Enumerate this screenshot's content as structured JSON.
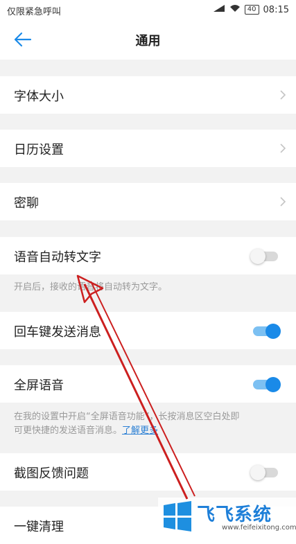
{
  "statusbar": {
    "carrier": "仅限紧急呼叫",
    "battery": "40",
    "time": "08:15"
  },
  "header": {
    "title": "通用"
  },
  "settings": {
    "font_size": "字体大小",
    "calendar": "日历设置",
    "secret_chat": "密聊",
    "voice_to_text": {
      "label": "语音自动转文字",
      "enabled": false
    },
    "voice_to_text_hint": "开启后，接收的语音将自动转为文字。",
    "enter_send": {
      "label": "回车键发送消息",
      "enabled": true
    },
    "fullscreen_voice": {
      "label": "全屏语音",
      "enabled": true
    },
    "fullscreen_hint_line1": "在我的设置中开启“全屏语音功能”，长按消息区空白处即",
    "fullscreen_hint_line2": "可更快捷的发送语音消息。",
    "learn_more": "了解更多",
    "screenshot_feedback": {
      "label": "截图反馈问题",
      "enabled": false
    },
    "one_key_clean": "一键清理"
  },
  "watermark": {
    "brand": "飞飞系统",
    "site": "www.feifeixitong.com"
  },
  "colors": {
    "accent": "#1a8ae8",
    "link": "#2a7fd4",
    "annotation": "#cc1f1f"
  }
}
